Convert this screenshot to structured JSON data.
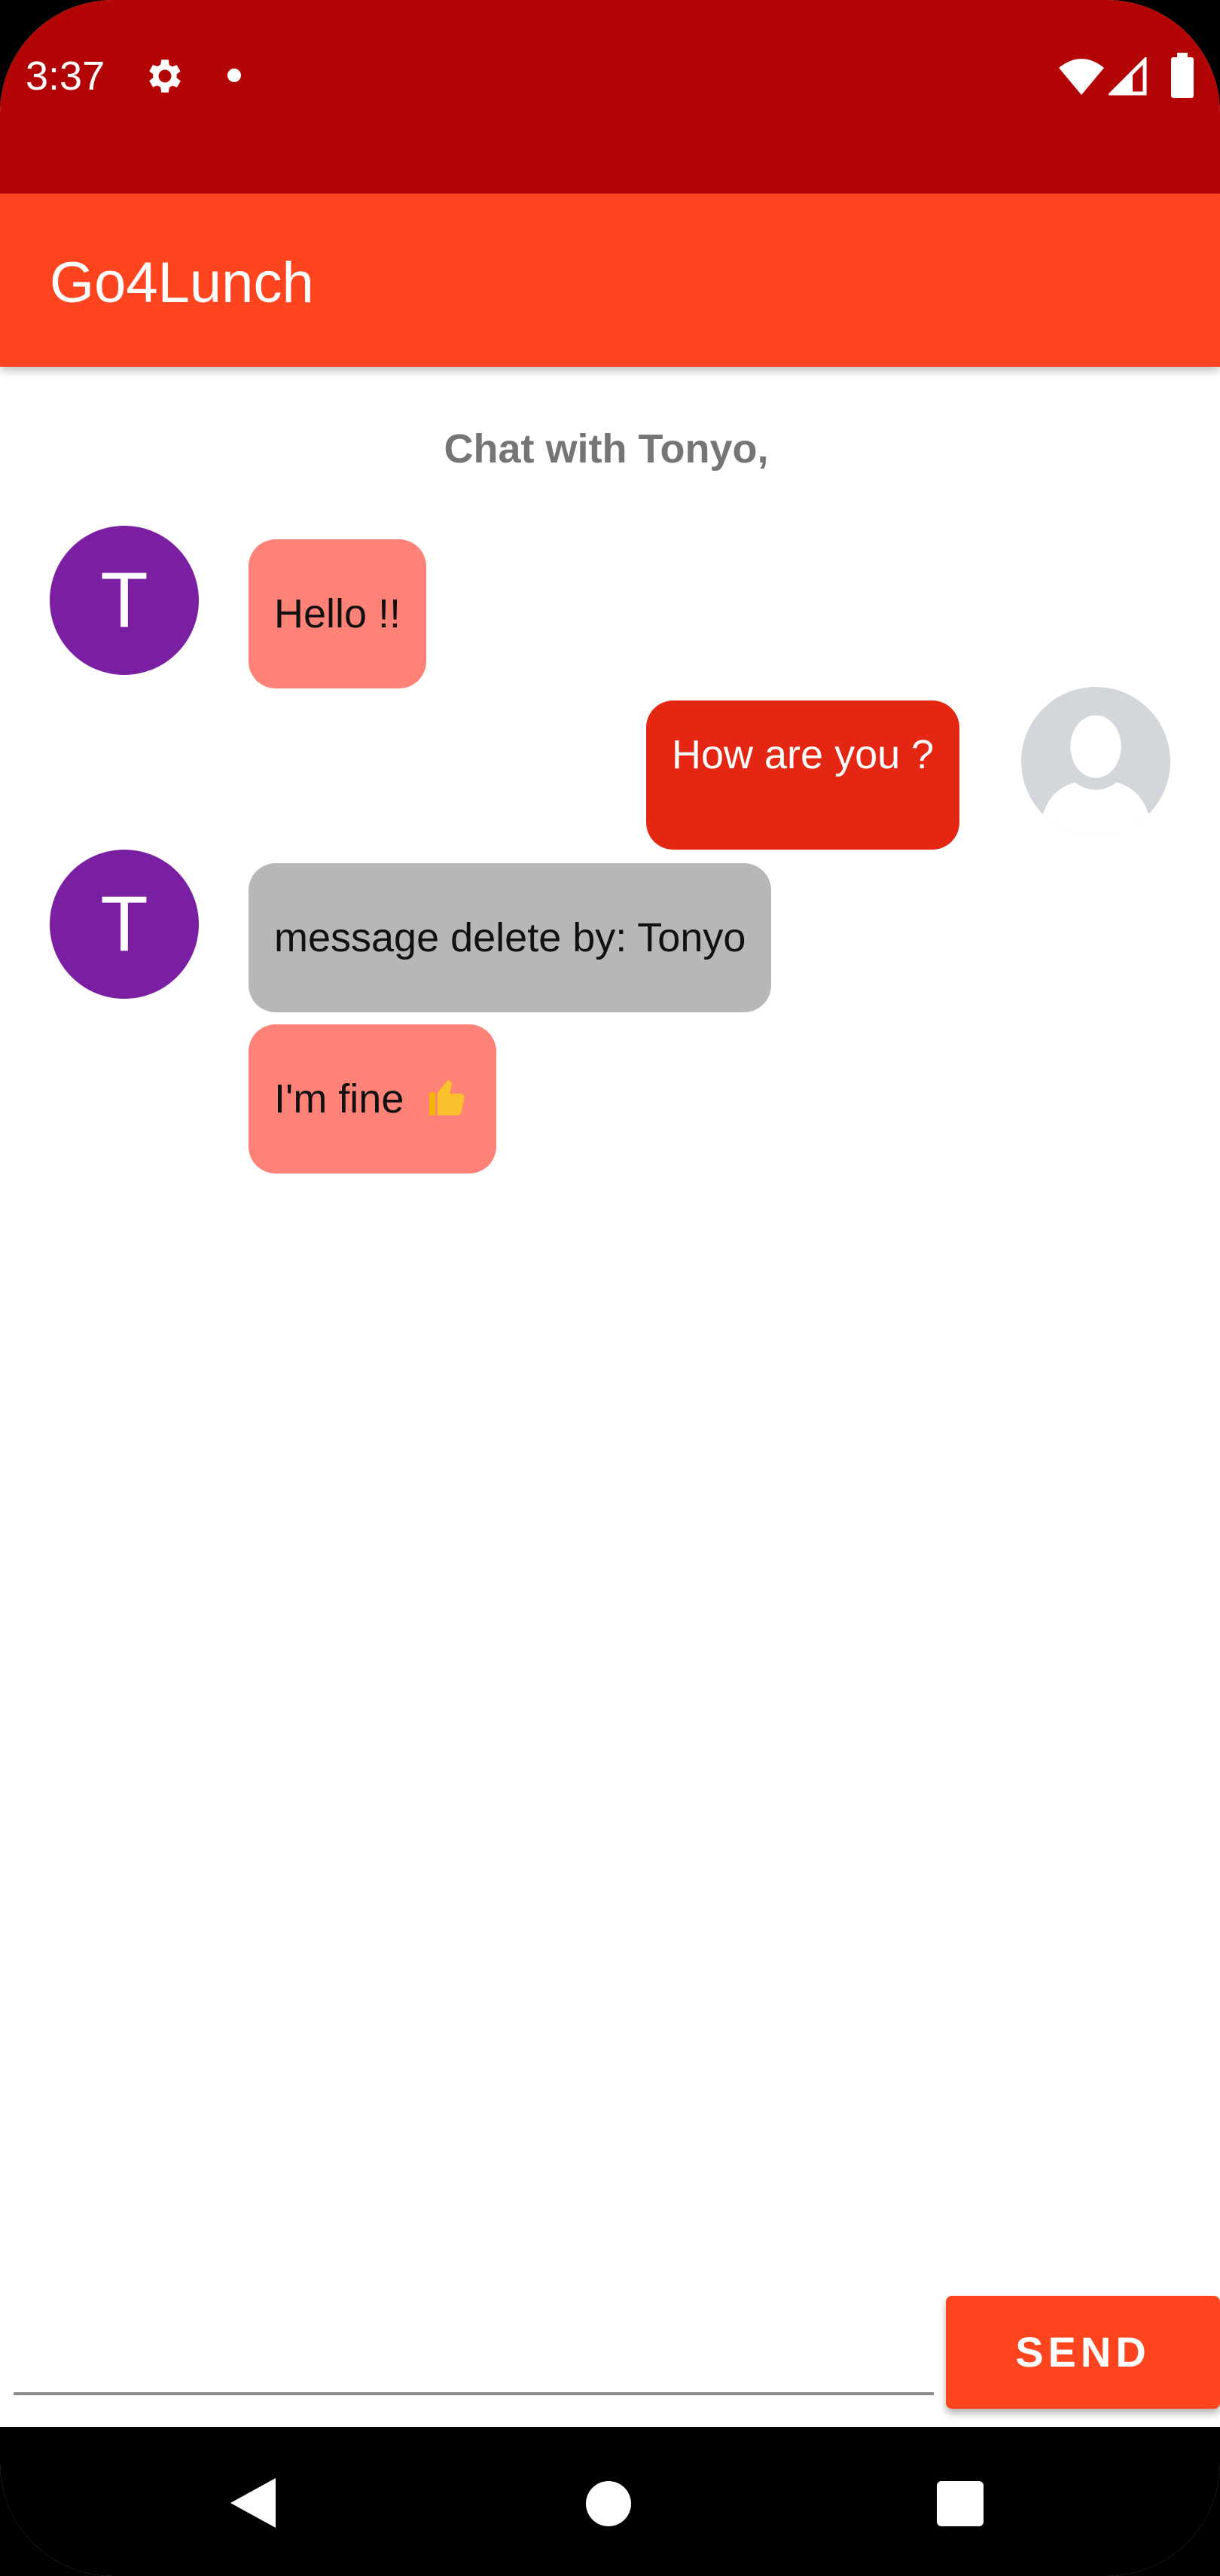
{
  "status_bar": {
    "time": "3:37",
    "icons": [
      "gear-icon",
      "notification-dot-icon",
      "wifi-icon",
      "signal-icon",
      "battery-icon"
    ],
    "color": "#b30505"
  },
  "app_bar": {
    "title": "Go4Lunch",
    "color": "#ff4520"
  },
  "chat": {
    "header": "Chat with Tonyo,",
    "contact_initial": "T",
    "messages": [
      {
        "from": "Tonyo",
        "side": "left",
        "text": "Hello !!",
        "style": "received"
      },
      {
        "from": "me",
        "side": "right",
        "text": "How are you ?",
        "style": "sent"
      },
      {
        "from": "Tonyo",
        "side": "left",
        "text": "message delete by: Tonyo",
        "style": "deleted"
      },
      {
        "from": "Tonyo",
        "side": "left",
        "text": "I'm fine",
        "emoji": "thumbs-up-icon",
        "style": "received"
      }
    ]
  },
  "composer": {
    "placeholder": "",
    "value": "",
    "send_label": "SEND"
  },
  "colors": {
    "avatar": "#7b1fa2",
    "received_bubble": "#ff8278",
    "sent_bubble": "#e32712",
    "deleted_bubble": "#b7b7b7"
  },
  "nav_bar": {
    "buttons": [
      "back-icon",
      "home-icon",
      "recents-icon"
    ]
  }
}
